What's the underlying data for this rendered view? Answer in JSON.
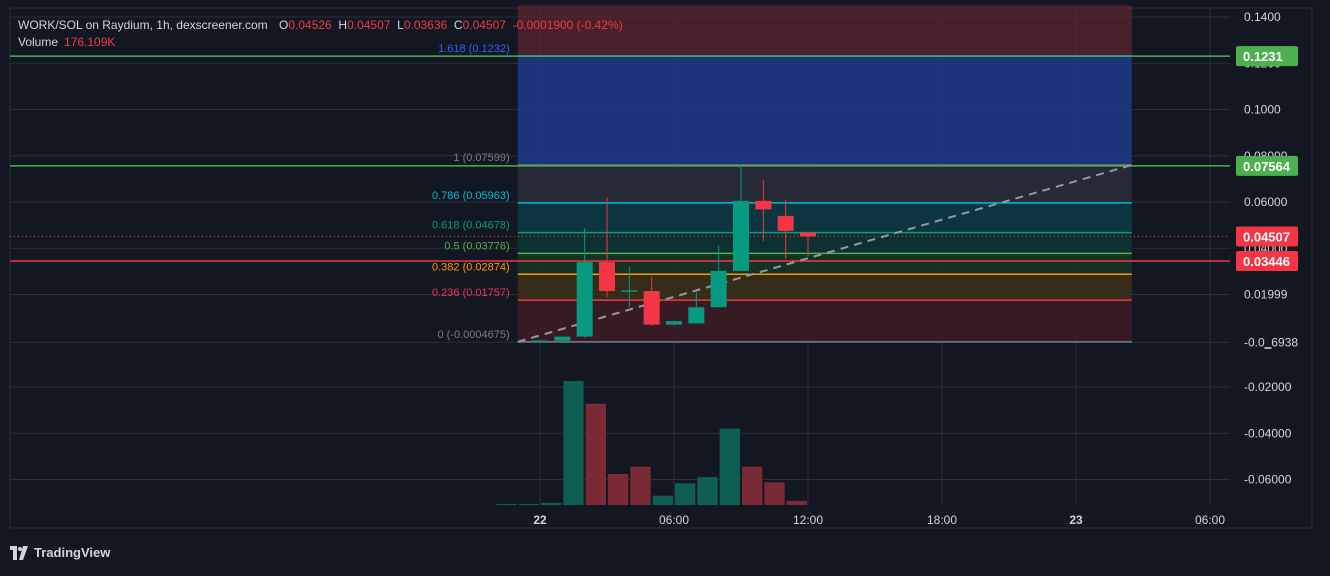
{
  "legend": {
    "title": "WORK/SOL on Raydium, 1h, dexscreener.com",
    "o_label": "O",
    "o_value": "0.04526",
    "h_label": "H",
    "h_value": "0.04507",
    "l_label": "L",
    "l_value": "0.03636",
    "c_label": "C",
    "c_value": "0.04507",
    "change": "-0.0001900 (-0.42%)",
    "volume_label": "Volume",
    "volume_value": "176.109K"
  },
  "brand": "TradingView",
  "colors": {
    "background": "#131722",
    "up": "#089981",
    "down": "#f23645",
    "grid": "#2a2e39",
    "green_line": "#4caf50",
    "red_line": "#f23645"
  },
  "chart_data": {
    "type": "candlestick",
    "price_axis": {
      "ticks": [
        {
          "value": 0.14,
          "label": "0.1400"
        },
        {
          "value": 0.12,
          "label": "0.1200"
        },
        {
          "value": 0.1,
          "label": "0.1000"
        },
        {
          "value": 0.08,
          "label": "0.08000"
        },
        {
          "value": 0.06,
          "label": "0.06000"
        },
        {
          "value": 0.04,
          "label": "0.04000"
        },
        {
          "value": 0.01999,
          "label": "0.01999"
        },
        {
          "value": -0.00069,
          "label": "-0.0‗6938"
        },
        {
          "value": -0.02,
          "label": "-0.02000"
        },
        {
          "value": -0.04,
          "label": "-0.04000"
        },
        {
          "value": -0.06,
          "label": "-0.06000"
        }
      ],
      "range": [
        -0.07,
        0.145
      ]
    },
    "time_axis": {
      "ticks": [
        {
          "hour": 0,
          "label": "22",
          "bold": true
        },
        {
          "hour": 6,
          "label": "06:00",
          "bold": false
        },
        {
          "hour": 12,
          "label": "12:00",
          "bold": false
        },
        {
          "hour": 18,
          "label": "18:00",
          "bold": false
        },
        {
          "hour": 24,
          "label": "23",
          "bold": true
        },
        {
          "hour": 30,
          "label": "06:00",
          "bold": false
        }
      ]
    },
    "price_labels": [
      {
        "value": 0.1231,
        "label": "0.1231",
        "color": "#4caf50"
      },
      {
        "value": 0.07564,
        "label": "0.07564",
        "color": "#4caf50"
      },
      {
        "value": 0.04507,
        "label": "0.04507",
        "color": "#f23645"
      },
      {
        "value": 0.03446,
        "label": "0.03446",
        "color": "#f23645"
      }
    ],
    "horizontal_lines": [
      {
        "value": 0.1231,
        "color": "#4caf50"
      },
      {
        "value": 0.07564,
        "color": "#4caf50"
      },
      {
        "value": 0.03446,
        "color": "#f23645"
      }
    ],
    "fib": {
      "start_hour": -1,
      "end_hour": 26.5,
      "top_value": 0.145,
      "levels": [
        {
          "ratio": "1.618",
          "value": 0.1232,
          "label": "1.618 (0.1232)",
          "color": "#2962ff",
          "fill": "#1e3a8a"
        },
        {
          "ratio": "1",
          "value": 0.07599,
          "label": "1 (0.07599)",
          "color": "#787b86",
          "fill": "#2a2e39"
        },
        {
          "ratio": "0.786",
          "value": 0.05963,
          "label": "0.786 (0.05963)",
          "color": "#00bcd4",
          "fill": "#0d3b44"
        },
        {
          "ratio": "0.618",
          "value": 0.04678,
          "label": "0.618 (0.04678)",
          "color": "#089981",
          "fill": "#0c3532"
        },
        {
          "ratio": "0.5",
          "value": 0.03776,
          "label": "0.5 (0.03776)",
          "color": "#4caf50",
          "fill": "#173623"
        },
        {
          "ratio": "0.382",
          "value": 0.02874,
          "label": "0.382 (0.02874)",
          "color": "#ff9800",
          "fill": "#3b2f17"
        },
        {
          "ratio": "0.236",
          "value": 0.01757,
          "label": "0.236 (0.01757)",
          "color": "#f23645",
          "fill": "#3d1c24"
        },
        {
          "ratio": "0",
          "value": -0.0004675,
          "label": "0 (-0.0004675)",
          "color": "#787b86",
          "fill": "#3d1c24"
        }
      ]
    },
    "trendline": {
      "start": {
        "hour": -1,
        "value": -0.0004675
      },
      "end": {
        "hour": 26.5,
        "value": 0.07599
      }
    },
    "candles": [
      {
        "hour": 0,
        "o": 0.0,
        "h": 0.0002,
        "l": -0.0005,
        "c": 0.0001
      },
      {
        "hour": 1,
        "o": 0.0,
        "h": 0.0005,
        "l": -0.0005,
        "c": 0.0018
      },
      {
        "hour": 2,
        "o": 0.0018,
        "h": 0.0485,
        "l": 0.0015,
        "c": 0.034
      },
      {
        "hour": 3,
        "o": 0.034,
        "h": 0.062,
        "l": 0.019,
        "c": 0.0215
      },
      {
        "hour": 4,
        "o": 0.0215,
        "h": 0.032,
        "l": 0.0145,
        "c": 0.0218
      },
      {
        "hour": 5,
        "o": 0.0215,
        "h": 0.0278,
        "l": 0.0065,
        "c": 0.007
      },
      {
        "hour": 6,
        "o": 0.007,
        "h": 0.008,
        "l": 0.0065,
        "c": 0.0085
      },
      {
        "hour": 7,
        "o": 0.0075,
        "h": 0.021,
        "l": 0.0075,
        "c": 0.0145
      },
      {
        "hour": 8,
        "o": 0.0145,
        "h": 0.0412,
        "l": 0.0145,
        "c": 0.0302
      },
      {
        "hour": 9,
        "o": 0.0302,
        "h": 0.076,
        "l": 0.03,
        "c": 0.0605
      },
      {
        "hour": 10,
        "o": 0.0605,
        "h": 0.0695,
        "l": 0.043,
        "c": 0.0568
      },
      {
        "hour": 11,
        "o": 0.054,
        "h": 0.0608,
        "l": 0.0355,
        "c": 0.0475
      },
      {
        "hour": 12,
        "o": 0.0468,
        "h": 0.047,
        "l": 0.0365,
        "c": 0.0451
      }
    ],
    "volume": [
      {
        "hour": -1.5,
        "v": 1,
        "up": true
      },
      {
        "hour": -0.5,
        "v": 1,
        "up": true
      },
      {
        "hour": 0.5,
        "v": 2,
        "up": true
      },
      {
        "hour": 1.5,
        "v": 120,
        "up": true
      },
      {
        "hour": 2.5,
        "v": 98,
        "up": false
      },
      {
        "hour": 3.5,
        "v": 30,
        "up": false
      },
      {
        "hour": 4.5,
        "v": 37,
        "up": false
      },
      {
        "hour": 5.5,
        "v": 9,
        "up": true
      },
      {
        "hour": 6.5,
        "v": 21,
        "up": true
      },
      {
        "hour": 7.5,
        "v": 27,
        "up": true
      },
      {
        "hour": 8.5,
        "v": 74,
        "up": true
      },
      {
        "hour": 9.5,
        "v": 37,
        "up": false
      },
      {
        "hour": 10.5,
        "v": 22,
        "up": false
      },
      {
        "hour": 11.5,
        "v": 4,
        "up": false
      }
    ]
  }
}
